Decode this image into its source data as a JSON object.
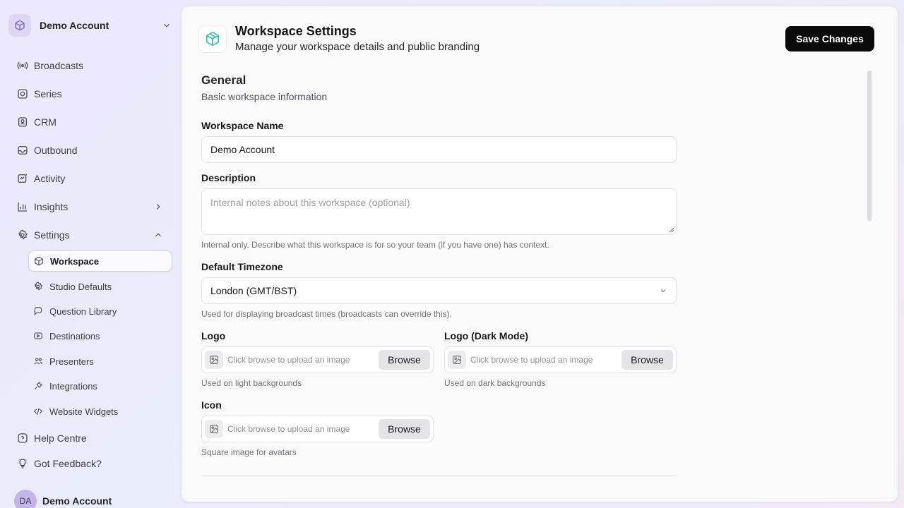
{
  "sidebar": {
    "account_name": "Demo Account",
    "nav": [
      {
        "label": "Broadcasts",
        "icon": "broadcast-icon"
      },
      {
        "label": "Series",
        "icon": "series-icon"
      },
      {
        "label": "CRM",
        "icon": "contacts-icon"
      },
      {
        "label": "Outbound",
        "icon": "inbox-icon"
      },
      {
        "label": "Activity",
        "icon": "activity-icon"
      },
      {
        "label": "Insights",
        "icon": "bar-chart-icon"
      },
      {
        "label": "Settings",
        "icon": "gear-icon"
      }
    ],
    "settings_sub": [
      {
        "label": "Workspace",
        "icon": "box-icon",
        "active": true
      },
      {
        "label": "Studio Defaults",
        "icon": "gear-icon"
      },
      {
        "label": "Question Library",
        "icon": "question-icon"
      },
      {
        "label": "Destinations",
        "icon": "video-icon"
      },
      {
        "label": "Presenters",
        "icon": "users-icon"
      },
      {
        "label": "Integrations",
        "icon": "plug-icon"
      },
      {
        "label": "Website Widgets",
        "icon": "code-icon"
      }
    ],
    "footer": [
      {
        "label": "Help Centre",
        "icon": "help-icon"
      },
      {
        "label": "Got Feedback?",
        "icon": "lightbulb-icon"
      }
    ],
    "user": {
      "initials": "DA",
      "name": "Demo Account"
    }
  },
  "header": {
    "title": "Workspace Settings",
    "subtitle": "Manage your workspace details and public branding",
    "save_label": "Save Changes"
  },
  "general": {
    "title": "General",
    "subtitle": "Basic workspace information",
    "name_label": "Workspace Name",
    "name_value": "Demo Account",
    "desc_label": "Description",
    "desc_placeholder": "Internal notes about this workspace (optional)",
    "desc_hint": "Internal only. Describe what this workspace is for so your team (if you have one) has context.",
    "tz_label": "Default Timezone",
    "tz_value": "London (GMT/BST)",
    "tz_hint": "Used for displaying broadcast times (broadcasts can override this).",
    "logo_label": "Logo",
    "logo_hint": "Used on light backgrounds",
    "logo_dark_label": "Logo (Dark Mode)",
    "logo_dark_hint": "Used on dark backgrounds",
    "icon_label": "Icon",
    "icon_hint": "Square image for avatars",
    "upload_placeholder": "Click browse to upload an image",
    "browse_label": "Browse"
  },
  "colors": {
    "accent": "#0a0a0a",
    "icon_teal": "#3cbfa3",
    "sidebar_icon": "#52525b"
  }
}
